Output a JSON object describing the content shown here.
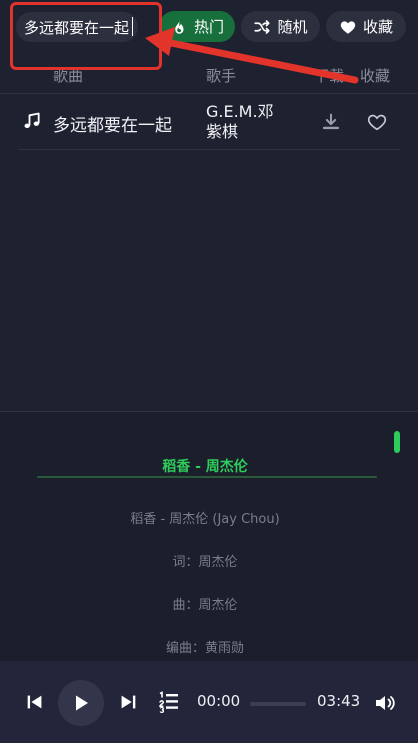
{
  "search": {
    "value": "多远都要在一起"
  },
  "filters": {
    "hot": "热门",
    "random": "随机",
    "favorites": "收藏"
  },
  "table": {
    "headers": {
      "song": "歌曲",
      "artist": "歌手",
      "download": "下载",
      "favorite": "收藏"
    },
    "rows": [
      {
        "song": "多远都要在一起",
        "artist": "G.E.M.邓紫棋"
      }
    ]
  },
  "lyrics": {
    "title": "稻香 - 周杰伦",
    "lines": [
      "稻香 - 周杰伦 (Jay Chou)",
      "词：周杰伦",
      "曲：周杰伦",
      "编曲：黄雨勋"
    ]
  },
  "player": {
    "current_time": "00:00",
    "duration": "03:43",
    "progress": 0
  },
  "colors": {
    "accent": "#2ecc5a",
    "hot_pill": "#17703b",
    "annotation": "#e2342a",
    "background": "#1e2130"
  }
}
